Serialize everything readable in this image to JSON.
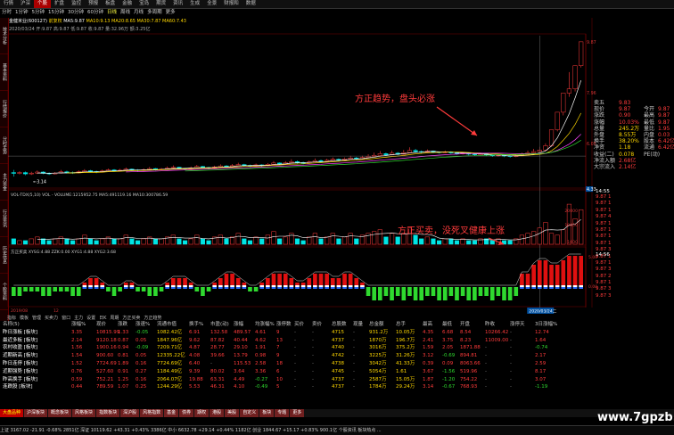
{
  "menu": [
    "行情",
    "沪深",
    "个股",
    "扩盘",
    "监控",
    "预报",
    "板盘",
    "金融",
    "宝岛",
    "期货",
    "资讯",
    "生成",
    "全景",
    "财报和",
    "数据"
  ],
  "tabs": [
    "分时",
    "1分钟",
    "5分钟",
    "15分钟",
    "30分钟",
    "60分钟",
    "日线",
    "周线",
    "月线",
    "多周期",
    "更多"
  ],
  "side_tabs": [
    "技术分析",
    "基本资料",
    "行情报价",
    "分时走势",
    "主力资金",
    "行业资讯",
    "历史信息",
    "个股资料"
  ],
  "info": {
    "stock": "金健米业(600127)",
    "mode": "前复权",
    "indicator": "MA5:9.87",
    "line1": "MA10:9.13  MA20:8.65  MA30:7.87  MA60:7.43",
    "line2": "2020/03/24  开:9.87  高:9.87  低:9.87  收:9.87  量:32.96万  额:3.25亿"
  },
  "price_axis": [
    "9.87",
    "7.96",
    "6.05",
    "4.14",
    "3.14",
    "4.33"
  ],
  "annotation_1": "方正趋势，盘头必涨",
  "annotation_2": "方正买卖，没死叉健康上涨",
  "vol_label": "VOL-TDX(5,10)  VOL - VOLUME:1215952.75  MA5:491119.16  MA10:300786.59",
  "vol_axis": [
    "20000",
    "10000",
    "1000"
  ],
  "ind_label": "方正买卖  XYSG:4.88  ZZK:0.00  XYG1:4.88  XYG2:3.68",
  "ind_axis": [
    "5.00",
    "0.00"
  ],
  "date_left": "2019/08",
  "date_mid": "12",
  "date_cursor": "2020/03/24二",
  "quote_time": "14:55",
  "quote_time2": "14:56",
  "quote": [
    {
      "k": "卖五",
      "v": "9.83",
      "v2": "",
      "c1": "#ff3b3b"
    },
    {
      "k": "现价",
      "v": "9.87",
      "v2": "今开",
      "v3": "9.87",
      "c1": "#ff3b3b"
    },
    {
      "k": "涨跌",
      "v": "0.90",
      "v2": "最高",
      "v3": "9.87",
      "c1": "#ff3b3b"
    },
    {
      "k": "涨幅",
      "v": "10.03%",
      "v2": "最低",
      "v3": "9.87",
      "c1": "#ff3b3b"
    },
    {
      "k": "总量",
      "v": "245.2万",
      "v2": "量比",
      "v3": "1.95",
      "c1": "#ffd700"
    },
    {
      "k": "外盘",
      "v": "8.55万",
      "v2": "内盘",
      "v3": "0.03",
      "c1": "#ffd700"
    },
    {
      "k": "换手",
      "v": "38.20%",
      "v2": "股本",
      "v3": "6.42亿",
      "c1": "#ffd700"
    },
    {
      "k": "净资",
      "v": "1.18",
      "v2": "流通",
      "v3": "6.42亿",
      "c1": "#ffd700"
    },
    {
      "k": "收益(二)",
      "v": "0.078",
      "v2": "PE(动)",
      "v3": "",
      "c1": "#ffd700"
    },
    {
      "k": "净流入额",
      "v": "2.68亿",
      "v2": "",
      "v3": "",
      "c1": "#ff3b3b"
    },
    {
      "k": "大宗流入",
      "v": "2.14亿",
      "v2": "",
      "v3": "",
      "c1": "#ff3b3b"
    }
  ],
  "mini_list": [
    "9.87 1",
    "9.87 1",
    "9.87 1",
    "9.87 4",
    "9.87 1",
    "9.87 1",
    "9.87 1",
    "9.87 1",
    "9.87 3",
    "9.87 1",
    "9.87 1",
    "9.87 3",
    "9.87 2",
    "9.87 1",
    "9.87 3",
    "9.87 3"
  ],
  "subtabs": [
    "指标",
    "模板",
    "管理",
    "买卖力",
    "窗口",
    "主力",
    "设置",
    "日K",
    "周期",
    "方正买卖",
    "方正趋势"
  ],
  "table_headers": [
    "名称(5)",
    "涨幅%",
    "现价",
    "涨跌",
    "涨速%",
    "流通市值",
    "换手%",
    "市盈(动)",
    "涨幅",
    "均涨幅%",
    "涨停数",
    "买价",
    "卖价",
    "总股数",
    "现量",
    "总金额",
    "总手",
    "最高",
    "最低",
    "开盘",
    "昨收",
    "涨停天",
    "3日涨幅%"
  ],
  "table_rows": [
    [
      "昨日涨板 [板块]",
      "3.35",
      "10815.99",
      "1.33",
      "-0.05",
      "1082.42亿",
      "6.91",
      "132.58",
      "489.57",
      "4.61",
      "9",
      "-",
      "-",
      "4715",
      "-",
      "931.2万",
      "10.05万",
      "4.35",
      "6.68",
      "8.54",
      "10266.42",
      "-",
      "12.74"
    ],
    [
      "最近多板 [板块]",
      "2.14",
      "9120.18",
      "0.87",
      "0.05",
      "1847.96亿",
      "9.62",
      "87.82",
      "40.44",
      "4.62",
      "13",
      "-",
      "-",
      "4737",
      "-",
      "1870万",
      "196.7万",
      "2.41",
      "3.75",
      "8.23",
      "11009.00",
      "-",
      "1.64"
    ],
    [
      "农村收盈 [板块]",
      "1.56",
      "1900.16",
      "0.94",
      "-0.09",
      "7209.71亿",
      "4.87",
      "28.77",
      "29.10",
      "1.91",
      "7",
      "-",
      "-",
      "4740",
      "-",
      "3016万",
      "375.2万",
      "1.59",
      "2.05",
      "1871.88",
      "-",
      "-",
      "-0.74"
    ],
    [
      "近期新高 [板块]",
      "1.54",
      "900.60",
      "0.81",
      "0.05",
      "12335.22亿",
      "4.08",
      "39.66",
      "13.79",
      "0.98",
      "9",
      "-",
      "-",
      "4742",
      "-",
      "3225万",
      "31.26万",
      "3.12",
      "-0.69",
      "894.81",
      "-",
      "-",
      "2.17"
    ],
    [
      "昨日连停 [板块]",
      "1.52",
      "7724.69",
      "1.89",
      "0.16",
      "7724.69亿",
      "6.40",
      "-",
      "115.53",
      "2.58",
      "18",
      "-",
      "-",
      "4738",
      "-",
      "3042万",
      "41.33万",
      "0.39",
      "0.09",
      "8063.66",
      "-",
      "-",
      "2.59"
    ],
    [
      "近期强势 [板块]",
      "0.76",
      "527.60",
      "0.91",
      "0.27",
      "1184.49亿",
      "9.39",
      "80.02",
      "3.64",
      "3.36",
      "6",
      "-",
      "-",
      "4745",
      "-",
      "5054万",
      "1.61",
      "3.67",
      "-1.56",
      "519.96",
      "-",
      "-",
      "8.17"
    ],
    [
      "昨高换手 [板块]",
      "0.59",
      "752.21",
      "1.25",
      "0.16",
      "2064.07亿",
      "19.88",
      "63.31",
      "4.49",
      "-0.27",
      "10",
      "-",
      "-",
      "4737",
      "-",
      "2587万",
      "15.05万",
      "1.87",
      "-1.20",
      "754.22",
      "-",
      "-",
      "3.07"
    ],
    [
      "连跌股 [板块]",
      "0.44",
      "789.59",
      "1.07",
      "0.25",
      "1244.29亿",
      "5.53",
      "46.31",
      "4.10",
      "-0.49",
      "5",
      "-",
      "-",
      "4737",
      "-",
      "1784万",
      "29.24万",
      "3.14",
      "-0.67",
      "768.93",
      "-",
      "-",
      "-1.19"
    ]
  ],
  "bottom_tabs": [
    "大盘品种",
    "沪深板块",
    "概念板块",
    "风格板块",
    "指数板块",
    "深沪股",
    "风格指数",
    "基金",
    "债券",
    "期权",
    "港股",
    "美股",
    "自定义",
    "板块",
    "专题",
    "更多"
  ],
  "status": "上证 3167.02  -21.91  -0.68%  2851亿   深证 10119.62  +43.31  +0.43%  3386亿   中小 6632.78  +29.14  +0.44%  1182亿   创业 1844.67  +15.17  +0.83%  900.1亿   个股资讯  板块热点  ...",
  "watermark": "www.7gpzb.com",
  "colors": {
    "up": "#ff3b3b",
    "down": "#2fd92f",
    "ma5": "#ffffff",
    "ma10": "#ffd700",
    "ma20": "#ff44ff",
    "ma30": "#2fd92f",
    "accent": "#ff3b3b",
    "cursor": "#00c0ff"
  },
  "chart_data": {
    "type": "candlestick",
    "candles": [
      [
        4.95,
        4.92,
        5.05,
        4.8
      ],
      [
        4.92,
        4.95,
        5.0,
        4.88
      ],
      [
        4.95,
        4.9,
        4.99,
        4.85
      ],
      [
        4.9,
        4.93,
        4.98,
        4.86
      ],
      [
        4.93,
        4.97,
        5.03,
        4.9
      ],
      [
        4.97,
        4.92,
        5.0,
        4.89
      ],
      [
        4.92,
        4.9,
        4.96,
        4.86
      ],
      [
        4.9,
        4.93,
        4.97,
        4.88
      ],
      [
        4.93,
        4.98,
        5.05,
        4.91
      ],
      [
        4.98,
        4.95,
        5.02,
        4.92
      ],
      [
        4.95,
        4.94,
        4.99,
        4.9
      ],
      [
        4.94,
        4.98,
        5.03,
        4.92
      ],
      [
        4.98,
        5.02,
        5.08,
        4.96
      ],
      [
        5.02,
        4.99,
        5.05,
        4.95
      ],
      [
        4.99,
        4.97,
        5.02,
        4.93
      ],
      [
        4.97,
        5.01,
        5.06,
        4.95
      ],
      [
        5.01,
        5.05,
        5.1,
        4.99
      ],
      [
        5.05,
        5.02,
        5.08,
        4.98
      ],
      [
        5.02,
        5.04,
        5.09,
        5.0
      ],
      [
        5.04,
        5.08,
        5.14,
        5.01
      ],
      [
        5.08,
        5.05,
        5.1,
        5.02
      ],
      [
        5.05,
        5.03,
        5.08,
        4.99
      ],
      [
        5.03,
        5.06,
        5.11,
        5.01
      ],
      [
        5.06,
        5.1,
        5.16,
        5.04
      ],
      [
        5.1,
        5.06,
        5.12,
        5.03
      ],
      [
        5.06,
        5.08,
        5.12,
        5.04
      ],
      [
        5.08,
        5.12,
        5.18,
        5.06
      ],
      [
        5.12,
        5.15,
        5.22,
        5.09
      ],
      [
        5.15,
        5.11,
        5.17,
        5.08
      ],
      [
        5.11,
        5.09,
        5.13,
        5.05
      ],
      [
        5.09,
        5.13,
        5.18,
        5.07
      ],
      [
        5.13,
        5.18,
        5.24,
        5.11
      ],
      [
        5.18,
        5.14,
        5.2,
        5.11
      ],
      [
        5.14,
        5.12,
        5.17,
        5.08
      ],
      [
        5.12,
        5.16,
        5.21,
        5.1
      ],
      [
        5.16,
        5.2,
        5.26,
        5.13
      ],
      [
        5.2,
        5.17,
        5.23,
        5.14
      ],
      [
        5.17,
        5.21,
        5.27,
        5.15
      ],
      [
        5.21,
        5.25,
        5.32,
        5.19
      ],
      [
        5.25,
        5.22,
        5.28,
        5.18
      ],
      [
        5.22,
        5.2,
        5.25,
        5.16
      ],
      [
        5.2,
        5.24,
        5.29,
        5.18
      ],
      [
        5.24,
        5.21,
        5.26,
        5.17
      ],
      [
        5.21,
        5.26,
        5.31,
        5.19
      ],
      [
        5.26,
        5.31,
        5.38,
        5.24
      ],
      [
        5.31,
        5.27,
        5.33,
        5.23
      ],
      [
        5.27,
        5.32,
        5.38,
        5.25
      ],
      [
        5.32,
        5.36,
        5.45,
        5.3
      ],
      [
        5.36,
        5.33,
        5.4,
        5.29
      ],
      [
        5.33,
        5.3,
        5.36,
        5.26
      ],
      [
        5.3,
        5.35,
        5.4,
        5.28
      ],
      [
        5.35,
        5.4,
        5.48,
        5.33
      ],
      [
        5.4,
        5.37,
        5.44,
        5.33
      ],
      [
        5.37,
        5.41,
        5.47,
        5.35
      ],
      [
        5.41,
        5.45,
        5.52,
        5.39
      ],
      [
        5.45,
        5.42,
        5.48,
        5.38
      ],
      [
        5.42,
        5.46,
        5.52,
        5.4
      ],
      [
        5.46,
        5.5,
        5.58,
        5.44
      ],
      [
        5.5,
        5.47,
        5.54,
        5.43
      ],
      [
        5.47,
        5.52,
        5.58,
        5.45
      ],
      [
        5.52,
        5.56,
        5.64,
        5.5
      ],
      [
        5.56,
        5.6,
        5.7,
        5.53
      ],
      [
        5.6,
        5.66,
        5.76,
        5.58
      ],
      [
        5.66,
        5.62,
        5.7,
        5.58
      ],
      [
        5.62,
        5.68,
        5.78,
        5.6
      ],
      [
        5.68,
        5.64,
        5.72,
        5.6
      ],
      [
        5.64,
        5.7,
        5.8,
        5.62
      ],
      [
        5.7,
        5.78,
        5.9,
        5.68
      ],
      [
        5.78,
        5.74,
        5.84,
        5.7
      ],
      [
        5.74,
        5.72,
        5.78,
        5.68
      ],
      [
        5.72,
        5.76,
        5.82,
        5.7
      ],
      [
        5.76,
        5.72,
        5.78,
        5.68
      ],
      [
        5.72,
        5.7,
        5.75,
        5.66
      ],
      [
        5.7,
        5.73,
        5.78,
        5.68
      ],
      [
        5.73,
        5.69,
        5.75,
        5.65
      ],
      [
        5.69,
        5.66,
        5.71,
        5.62
      ],
      [
        5.66,
        5.68,
        5.72,
        5.63
      ],
      [
        5.68,
        5.64,
        5.7,
        5.6
      ],
      [
        5.64,
        5.62,
        5.67,
        5.58
      ],
      [
        5.62,
        5.65,
        5.7,
        5.6
      ],
      [
        5.65,
        5.61,
        5.67,
        5.57
      ],
      [
        5.61,
        5.58,
        5.63,
        5.54
      ],
      [
        5.58,
        5.6,
        5.64,
        5.55
      ],
      [
        5.6,
        5.57,
        5.62,
        5.53
      ],
      [
        5.57,
        5.55,
        5.6,
        5.51
      ],
      [
        5.55,
        5.58,
        5.62,
        5.53
      ],
      [
        5.58,
        5.63,
        5.7,
        5.56
      ],
      [
        5.63,
        5.69,
        5.78,
        5.61
      ],
      [
        5.69,
        5.74,
        5.84,
        5.67
      ],
      [
        5.74,
        5.8,
        5.92,
        5.72
      ],
      [
        5.8,
        5.96,
        6.05,
        5.78
      ],
      [
        5.96,
        6.56,
        6.56,
        5.92
      ],
      [
        6.56,
        7.22,
        7.22,
        6.5
      ],
      [
        7.22,
        7.94,
        7.94,
        7.1
      ],
      [
        7.94,
        8.1,
        8.73,
        7.8
      ],
      [
        8.1,
        8.97,
        8.97,
        8.0
      ],
      [
        8.97,
        9.87,
        9.87,
        8.9
      ]
    ],
    "volume": [
      3,
      2,
      2,
      3,
      4,
      3,
      2,
      3,
      4,
      3,
      2,
      3,
      5,
      3,
      2,
      3,
      4,
      3,
      3,
      5,
      3,
      2,
      3,
      4,
      3,
      3,
      4,
      5,
      3,
      2,
      3,
      5,
      3,
      2,
      4,
      5,
      3,
      4,
      6,
      3,
      2,
      4,
      3,
      5,
      7,
      3,
      4,
      6,
      3,
      2,
      4,
      6,
      3,
      4,
      6,
      3,
      4,
      6,
      3,
      5,
      6,
      7,
      8,
      4,
      6,
      4,
      6,
      9,
      5,
      3,
      4,
      3,
      2,
      3,
      3,
      2,
      3,
      2,
      2,
      3,
      3,
      2,
      3,
      2,
      2,
      3,
      5,
      6,
      7,
      9,
      12,
      6,
      5,
      8,
      22,
      14,
      19
    ],
    "ind_pos": [
      0,
      0,
      0,
      0,
      0,
      0,
      0,
      0,
      0,
      0,
      0,
      0,
      1,
      2,
      2,
      1,
      0,
      0,
      0,
      1,
      1,
      0,
      0,
      0,
      0,
      0,
      1,
      2,
      2,
      2,
      1,
      0,
      0,
      0,
      1,
      2,
      3,
      3,
      2,
      1,
      0,
      0,
      1,
      2,
      3,
      3,
      3,
      2,
      1,
      1,
      2,
      3,
      3,
      3,
      2,
      2,
      3,
      3,
      2,
      1,
      0,
      0,
      0,
      0,
      0,
      0,
      0,
      0,
      0,
      0,
      0,
      0,
      0,
      0,
      0,
      0,
      0,
      0,
      0,
      0,
      0,
      0,
      0,
      0,
      0,
      0,
      3,
      3,
      5,
      6,
      6,
      5,
      5,
      6,
      7,
      7,
      7
    ],
    "ind_neg": [
      2,
      2,
      1,
      1,
      1,
      2,
      2,
      1,
      1,
      1,
      2,
      2,
      0,
      0,
      0,
      0,
      1,
      2,
      1,
      0,
      0,
      1,
      1,
      2,
      2,
      1,
      0,
      0,
      0,
      0,
      0,
      1,
      2,
      1,
      0,
      0,
      0,
      0,
      0,
      0,
      1,
      1,
      0,
      0,
      0,
      0,
      0,
      0,
      0,
      0,
      0,
      0,
      0,
      0,
      0,
      0,
      0,
      0,
      0,
      0,
      2,
      3,
      3,
      2,
      3,
      2,
      3,
      2,
      3,
      3,
      2,
      2,
      3,
      3,
      2,
      3,
      2,
      3,
      3,
      2,
      2,
      3,
      2,
      3,
      3,
      2,
      0,
      0,
      0,
      0,
      0,
      0,
      0,
      0,
      0,
      0,
      0
    ]
  }
}
